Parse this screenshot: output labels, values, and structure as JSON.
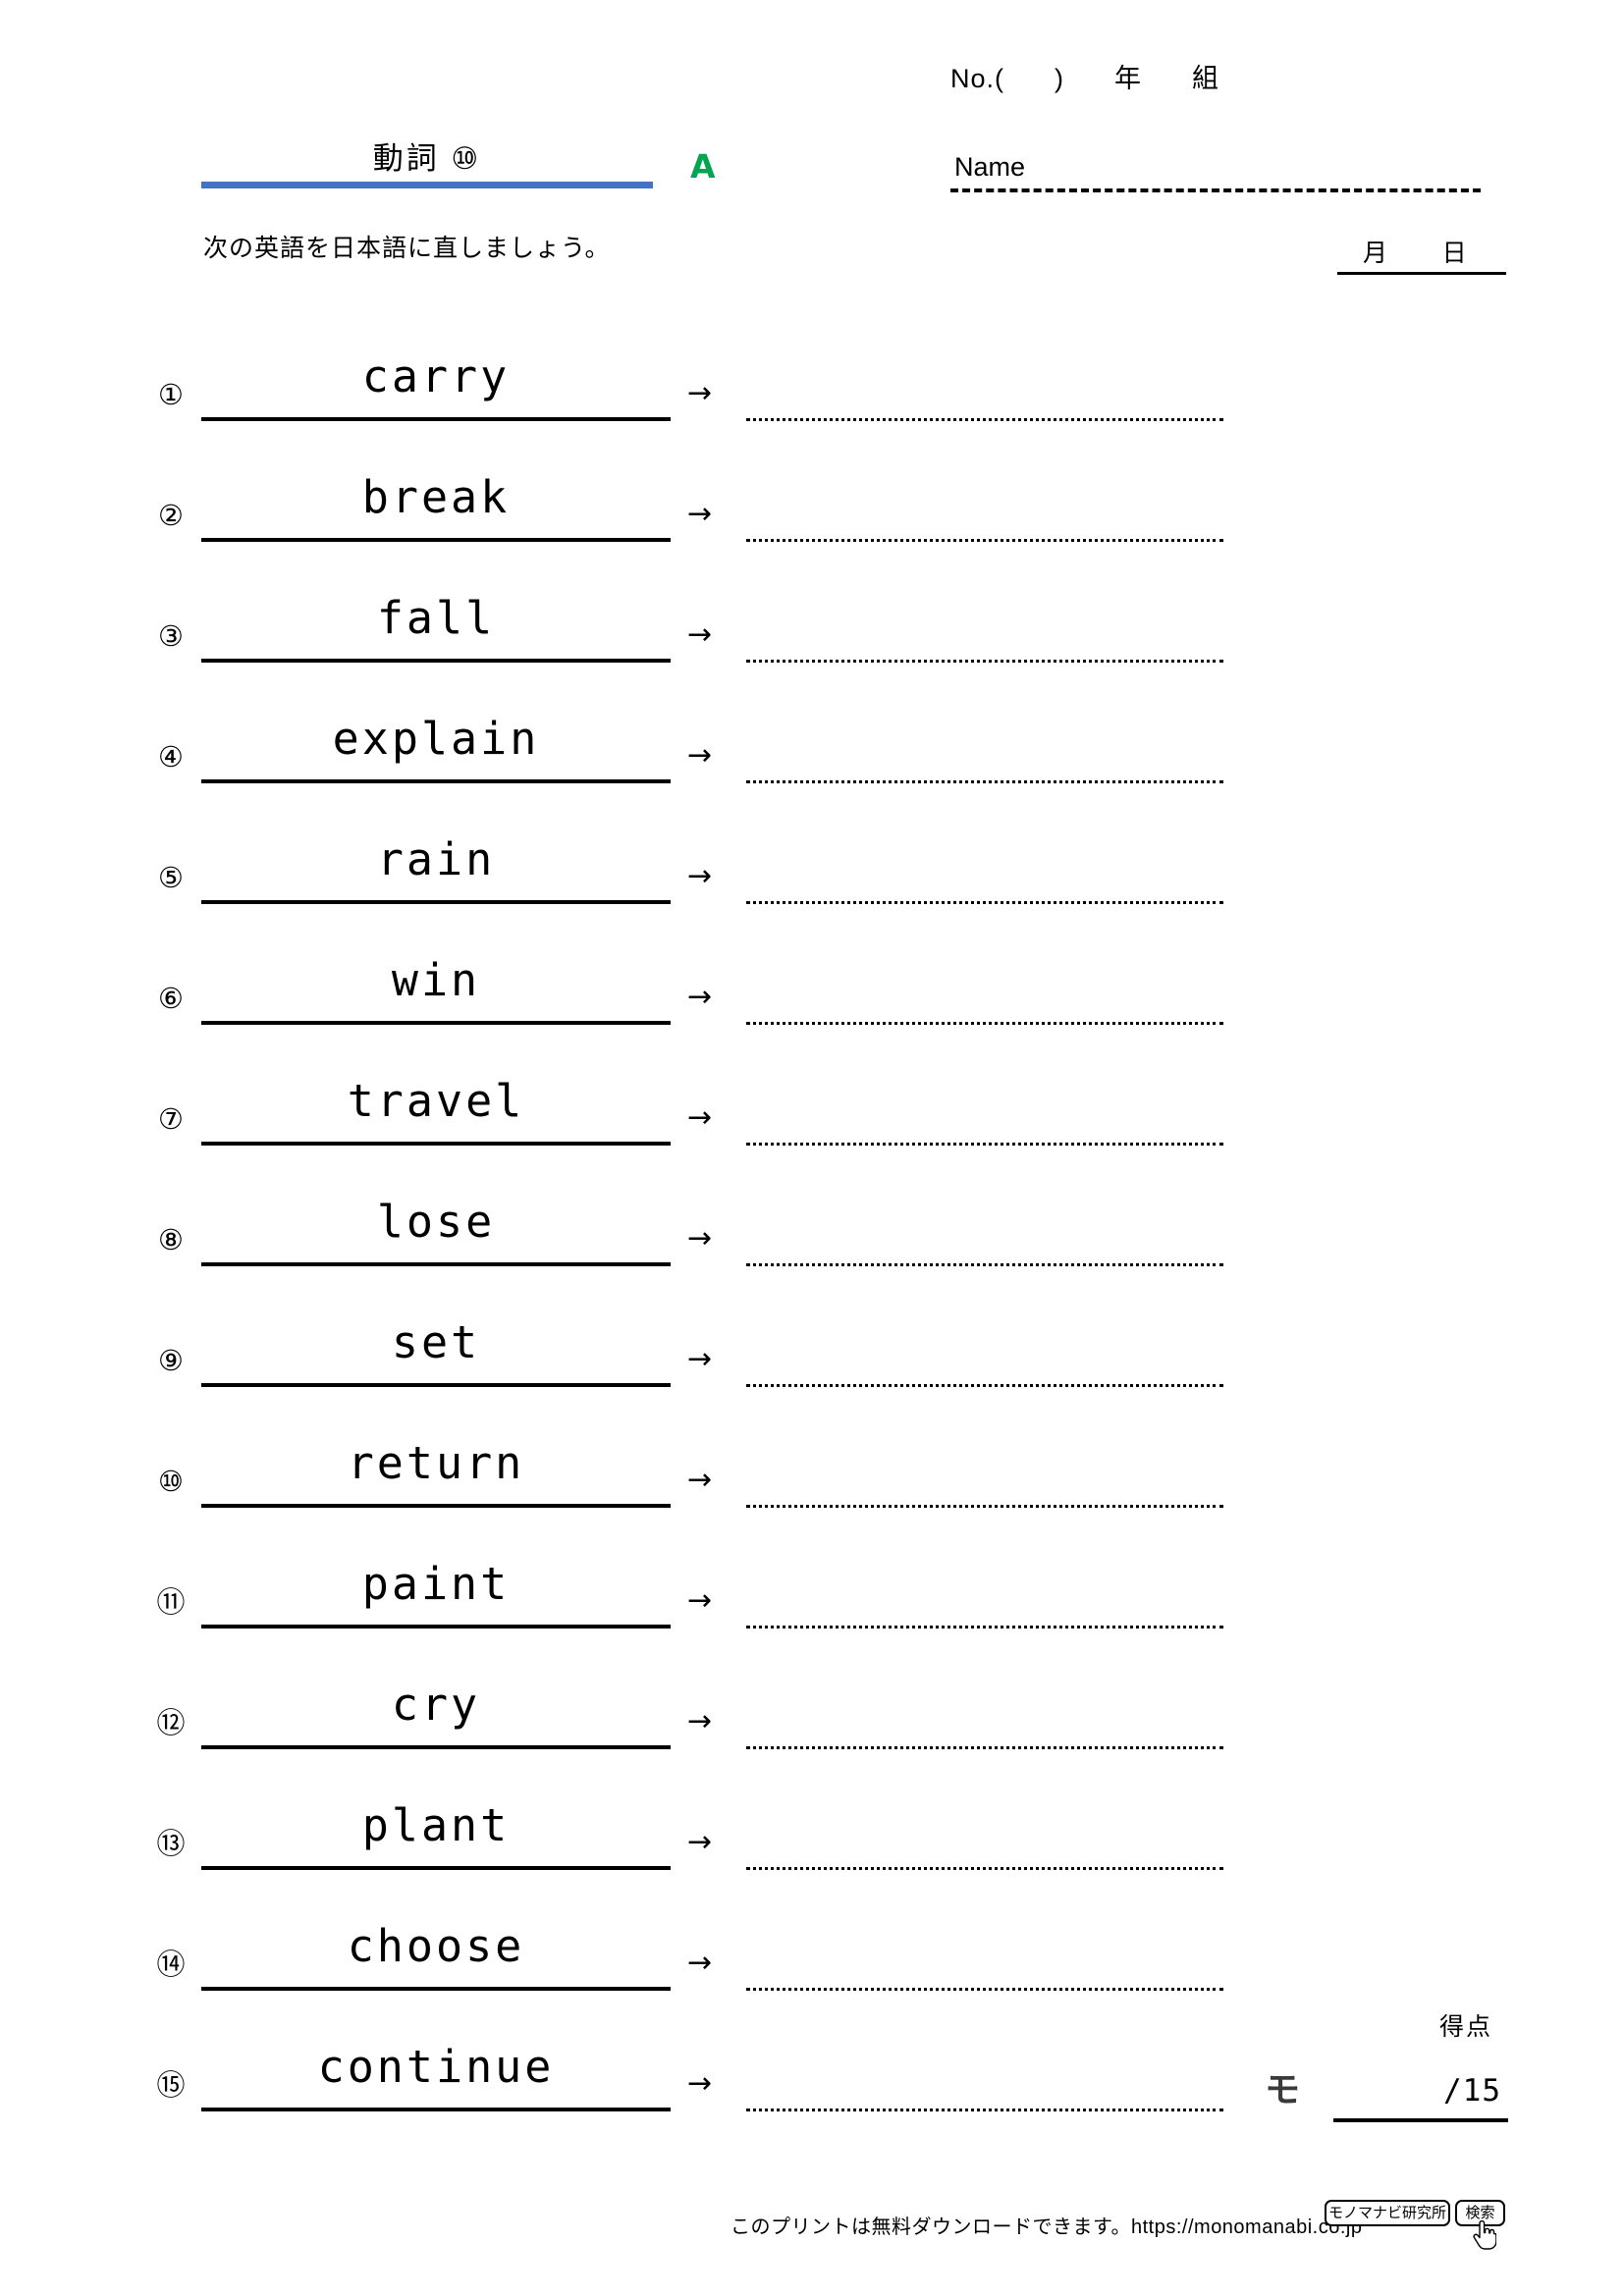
{
  "header": {
    "no_line": "No.(      )      年      組",
    "title": "動詞 ⑩",
    "section_mark": "A",
    "instruction": "次の英語を日本語に直しましょう。",
    "name_label": "Name",
    "date_label": "月      日",
    "title_rule_color": "#4472C4",
    "section_mark_color": "#00A550"
  },
  "questions": [
    {
      "number": "①",
      "word": "carry",
      "arrow": "→",
      "answer": ""
    },
    {
      "number": "②",
      "word": "break",
      "arrow": "→",
      "answer": ""
    },
    {
      "number": "③",
      "word": "fall",
      "arrow": "→",
      "answer": ""
    },
    {
      "number": "④",
      "word": "explain",
      "arrow": "→",
      "answer": ""
    },
    {
      "number": "⑤",
      "word": "rain",
      "arrow": "→",
      "answer": ""
    },
    {
      "number": "⑥",
      "word": "win",
      "arrow": "→",
      "answer": ""
    },
    {
      "number": "⑦",
      "word": "travel",
      "arrow": "→",
      "answer": ""
    },
    {
      "number": "⑧",
      "word": "lose",
      "arrow": "→",
      "answer": ""
    },
    {
      "number": "⑨",
      "word": "set",
      "arrow": "→",
      "answer": ""
    },
    {
      "number": "⑩",
      "word": "return",
      "arrow": "→",
      "answer": ""
    },
    {
      "number": "⑪",
      "word": "paint",
      "arrow": "→",
      "answer": ""
    },
    {
      "number": "⑫",
      "word": "cry",
      "arrow": "→",
      "answer": ""
    },
    {
      "number": "⑬",
      "word": "plant",
      "arrow": "→",
      "answer": ""
    },
    {
      "number": "⑭",
      "word": "choose",
      "arrow": "→",
      "answer": ""
    },
    {
      "number": "⑮",
      "word": "continue",
      "arrow": "→",
      "answer": ""
    }
  ],
  "score": {
    "label": "得点",
    "logo_mark": "モ",
    "total": "/15"
  },
  "footer": {
    "notice": "このプリントは無料ダウンロードできます。https://monomanabi.co.jp",
    "search_value": "モノマナビ研究所",
    "search_button": "検索"
  }
}
